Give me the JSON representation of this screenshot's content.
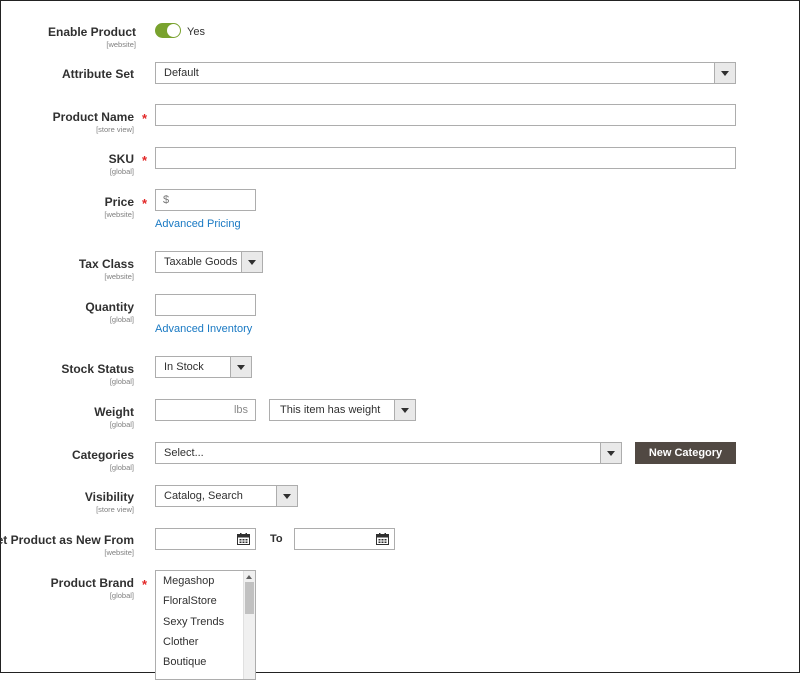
{
  "fields": {
    "enable_product": {
      "label": "Enable Product",
      "scope": "[website]",
      "value": "Yes"
    },
    "attribute_set": {
      "label": "Attribute Set",
      "value": "Default"
    },
    "product_name": {
      "label": "Product Name",
      "scope": "[store view]",
      "required": "*",
      "value": ""
    },
    "sku": {
      "label": "SKU",
      "scope": "[global]",
      "required": "*",
      "value": ""
    },
    "price": {
      "label": "Price",
      "scope": "[website]",
      "required": "*",
      "currency": "$",
      "link": "Advanced Pricing"
    },
    "tax_class": {
      "label": "Tax Class",
      "scope": "[website]",
      "value": "Taxable Goods"
    },
    "quantity": {
      "label": "Quantity",
      "scope": "[global]",
      "value": "",
      "link": "Advanced Inventory"
    },
    "stock_status": {
      "label": "Stock Status",
      "scope": "[global]",
      "value": "In Stock"
    },
    "weight": {
      "label": "Weight",
      "scope": "[global]",
      "unit": "lbs",
      "type_value": "This item has weight"
    },
    "categories": {
      "label": "Categories",
      "scope": "[global]",
      "placeholder": "Select...",
      "button": "New Category"
    },
    "visibility": {
      "label": "Visibility",
      "scope": "[store view]",
      "value": "Catalog, Search"
    },
    "new_from": {
      "label": "Set Product as New From",
      "scope": "[website]",
      "to_label": "To"
    },
    "product_brand": {
      "label": "Product Brand",
      "scope": "[global]",
      "required": "*",
      "options": [
        "Megashop",
        "FloralStore",
        "Sexy Trends",
        "Clother",
        "Boutique"
      ]
    }
  },
  "colors": {
    "accent": "#79a22e",
    "link": "#1979c3",
    "required": "#e22626",
    "button_dark": "#514943"
  },
  "icons": {
    "calendar": "calendar-icon",
    "dropdown": "chevron-down-icon"
  }
}
